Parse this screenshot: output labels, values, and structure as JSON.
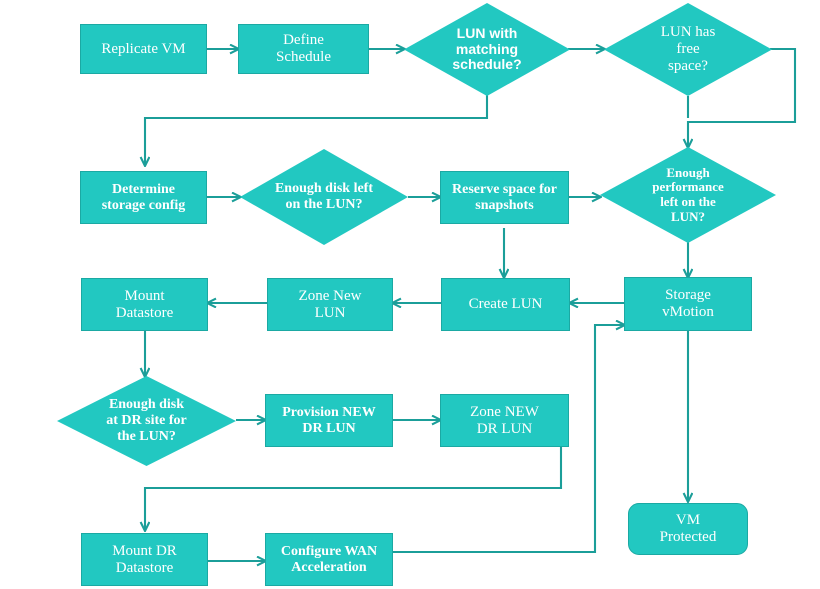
{
  "diagram": {
    "title": "VM replication and DR storage provisioning flowchart",
    "colors": {
      "node_fill": "#22C8C1",
      "node_stroke": "#1BA9A3",
      "connector": "#1B9E99",
      "label_text": "#FFFFFF",
      "background": "#FFFFFF"
    },
    "nodes": [
      {
        "id": "replicate-vm",
        "shape": "process",
        "label": "Replicate VM"
      },
      {
        "id": "define-schedule",
        "shape": "process",
        "label": "Define Schedule"
      },
      {
        "id": "lun-matching-schedule",
        "shape": "decision",
        "label": "LUN with matching schedule?"
      },
      {
        "id": "lun-free-space",
        "shape": "decision",
        "label": "LUN has free space?"
      },
      {
        "id": "determine-storage-config",
        "shape": "process",
        "label": "Determine storage config"
      },
      {
        "id": "enough-disk-left",
        "shape": "decision",
        "label": "Enough disk left on the LUN?"
      },
      {
        "id": "reserve-space",
        "shape": "process",
        "label": "Reserve space for snapshots"
      },
      {
        "id": "enough-performance",
        "shape": "decision",
        "label": "Enough performance left on the LUN?"
      },
      {
        "id": "mount-datastore",
        "shape": "process",
        "label": "Mount Datastore"
      },
      {
        "id": "zone-new-lun",
        "shape": "process",
        "label": "Zone New LUN"
      },
      {
        "id": "create-lun",
        "shape": "process",
        "label": "Create LUN"
      },
      {
        "id": "storage-vmotion",
        "shape": "process",
        "label": "Storage vMotion"
      },
      {
        "id": "enough-disk-dr",
        "shape": "decision",
        "label": "Enough disk at DR site for the LUN?"
      },
      {
        "id": "provision-new-dr-lun",
        "shape": "process",
        "label": "Provision NEW DR LUN"
      },
      {
        "id": "zone-new-dr-lun",
        "shape": "process",
        "label": "Zone NEW DR LUN"
      },
      {
        "id": "mount-dr-datastore",
        "shape": "process",
        "label": "Mount DR Datastore"
      },
      {
        "id": "configure-wan",
        "shape": "process",
        "label": "Configure WAN Acceleration"
      },
      {
        "id": "vm-protected",
        "shape": "terminator",
        "label": "VM Protected"
      }
    ],
    "labels": {
      "replicate_vm": "Replicate VM",
      "define_schedule_l1": "Define",
      "define_schedule_l2": "Schedule",
      "lun_matching_l1": "LUN with",
      "lun_matching_l2": "matching",
      "lun_matching_l3": "schedule?",
      "lun_free_l1": "LUN has",
      "lun_free_l2": "free",
      "lun_free_l3": "space?",
      "determine_l1": "Determine",
      "determine_l2": "storage config",
      "enough_disk_l1": "Enough disk left",
      "enough_disk_l2": "on the LUN?",
      "reserve_l1": "Reserve space for",
      "reserve_l2": "snapshots",
      "perf_l1": "Enough",
      "perf_l2": "performance",
      "perf_l3": "left on the",
      "perf_l4": "LUN?",
      "mount_ds_l1": "Mount",
      "mount_ds_l2": "Datastore",
      "zone_new_l1": "Zone New",
      "zone_new_l2": "LUN",
      "create_lun": "Create LUN",
      "storage_vmotion_l1": "Storage",
      "storage_vmotion_l2": "vMotion",
      "dr_disk_l1": "Enough disk",
      "dr_disk_l2": "at DR site for",
      "dr_disk_l3": "the LUN?",
      "provision_l1": "Provision NEW",
      "provision_l2": "DR LUN",
      "zone_dr_l1": "Zone NEW",
      "zone_dr_l2": "DR LUN",
      "mount_dr_l1": "Mount DR",
      "mount_dr_l2": "Datastore",
      "wan_l1": "Configure WAN",
      "wan_l2": "Acceleration",
      "vm_protected_l1": "VM",
      "vm_protected_l2": "Protected"
    },
    "edges": [
      {
        "from": "replicate-vm",
        "to": "define-schedule"
      },
      {
        "from": "define-schedule",
        "to": "lun-matching-schedule"
      },
      {
        "from": "lun-matching-schedule",
        "to": "lun-free-space"
      },
      {
        "from": "lun-matching-schedule",
        "to": "determine-storage-config"
      },
      {
        "from": "lun-free-space",
        "to": "enough-performance"
      },
      {
        "from": "lun-free-space",
        "to": "determine-storage-config"
      },
      {
        "from": "determine-storage-config",
        "to": "enough-disk-left"
      },
      {
        "from": "enough-disk-left",
        "to": "reserve-space"
      },
      {
        "from": "reserve-space",
        "to": "enough-performance"
      },
      {
        "from": "reserve-space",
        "to": "create-lun"
      },
      {
        "from": "enough-performance",
        "to": "storage-vmotion"
      },
      {
        "from": "storage-vmotion",
        "to": "create-lun"
      },
      {
        "from": "storage-vmotion",
        "to": "vm-protected"
      },
      {
        "from": "create-lun",
        "to": "zone-new-lun"
      },
      {
        "from": "zone-new-lun",
        "to": "mount-datastore"
      },
      {
        "from": "mount-datastore",
        "to": "enough-disk-dr"
      },
      {
        "from": "enough-disk-dr",
        "to": "provision-new-dr-lun"
      },
      {
        "from": "provision-new-dr-lun",
        "to": "zone-new-dr-lun"
      },
      {
        "from": "zone-new-dr-lun",
        "to": "mount-dr-datastore"
      },
      {
        "from": "mount-dr-datastore",
        "to": "configure-wan"
      },
      {
        "from": "configure-wan",
        "to": "storage-vmotion"
      }
    ]
  }
}
